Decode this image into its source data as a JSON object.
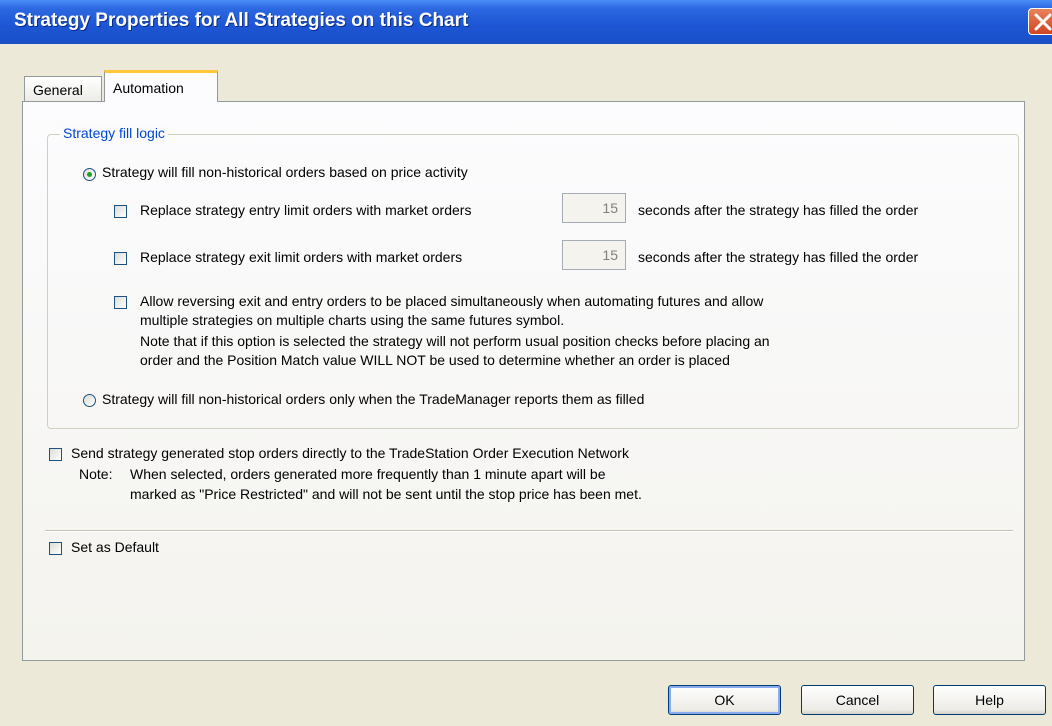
{
  "window": {
    "title": "Strategy Properties for All Strategies on this Chart"
  },
  "tabs": [
    {
      "label": "General",
      "active": false
    },
    {
      "label": "Automation",
      "active": true
    }
  ],
  "fill_logic": {
    "group_label": "Strategy fill logic",
    "option_price_activity": {
      "label": "Strategy will fill non-historical orders based on price activity",
      "selected": true
    },
    "replace_entry": {
      "label": "Replace strategy entry limit orders with market orders",
      "checked": false,
      "seconds_value": "15",
      "suffix": "seconds after the strategy has filled the order"
    },
    "replace_exit": {
      "label": "Replace strategy exit limit orders with market orders",
      "checked": false,
      "seconds_value": "15",
      "suffix": "seconds after the strategy has filled the order"
    },
    "allow_reversing": {
      "checked": false,
      "line1": "Allow reversing exit and entry orders to be placed simultaneously when automating futures and allow",
      "line2": "multiple strategies on multiple charts using the same futures symbol.",
      "line3": "Note that if this option is selected the strategy will not perform usual position checks before placing an",
      "line4": "order and the Position Match value WILL NOT be used to determine whether an order is placed"
    },
    "option_trademanager": {
      "label": "Strategy will fill non-historical orders only when the TradeManager reports them as filled",
      "selected": false
    }
  },
  "send_stop_orders": {
    "label": "Send strategy generated stop orders directly to the TradeStation Order Execution Network",
    "checked": false,
    "note_prefix": "Note:",
    "note_line1": "When selected, orders generated more frequently than 1 minute apart will be",
    "note_line2": "marked as \"Price Restricted\" and will not be sent until the stop price has been met."
  },
  "set_default": {
    "label": "Set as Default",
    "checked": false
  },
  "buttons": {
    "ok": "OK",
    "cancel": "Cancel",
    "help": "Help"
  }
}
